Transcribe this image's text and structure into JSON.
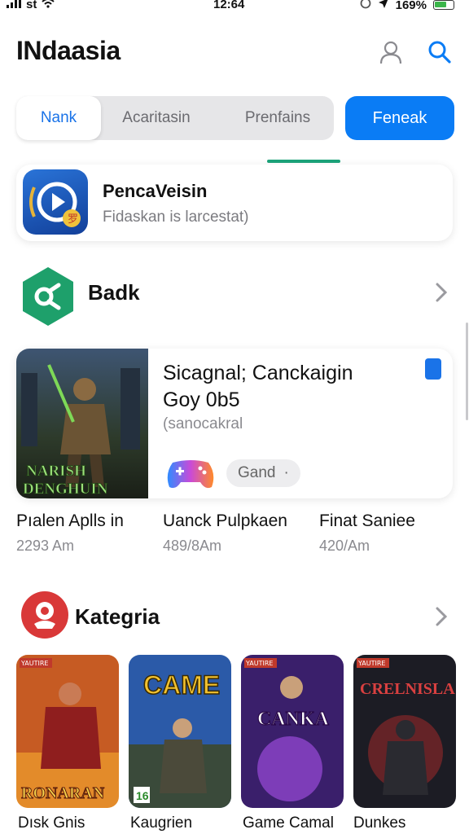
{
  "status_bar": {
    "carrier": "st",
    "time": "12:64",
    "battery": "169%"
  },
  "app": {
    "title": "INdaasia"
  },
  "segmented": {
    "items": [
      "Nank",
      "Acaritasin",
      "Prenfains"
    ],
    "active_index": 0
  },
  "primary_button": {
    "label": "Feneak"
  },
  "featured": {
    "title": "PencaVeisin",
    "subtitle": "Fidaskan is larcestat)"
  },
  "sections": [
    {
      "label": "Badk",
      "icon": "share-node-icon"
    },
    {
      "label": "Kategria",
      "icon": "emblem-icon"
    }
  ],
  "game_card": {
    "title_line1": "Sicagnal; Canckaigin",
    "title_line2": "Goy 0b5",
    "subtitle": "(sanocakral",
    "chip_label": "Gand",
    "chip_dot": "·",
    "art_title_1": "NARISH",
    "art_title_2": "DENGHUIN"
  },
  "trio": [
    {
      "title": "Pıalen Aplls in",
      "value": "2293 Am"
    },
    {
      "title": "Uanck Pulpkaen",
      "value": "489/8Am"
    },
    {
      "title": "Finat Saniee",
      "value": "420/Am"
    }
  ],
  "tiles": [
    {
      "label": "Dısk Gnis",
      "art_text": "RONARAN",
      "tag": "YAUTIRE",
      "colors": [
        "#b23c1f",
        "#e38b2a"
      ]
    },
    {
      "label": "Kaugrien",
      "art_text": "CAME",
      "tag": "16",
      "colors": [
        "#2b5aa8",
        "#f2c230"
      ]
    },
    {
      "label": "Game Camal",
      "art_text": "CANKA",
      "tag": "YAUTIRE",
      "colors": [
        "#3a1f6b",
        "#9a4ad8"
      ]
    },
    {
      "label": "Dunkes",
      "art_text": "CRELNISLA",
      "tag": "YAUTIRE",
      "colors": [
        "#1c1c24",
        "#a02a2a"
      ]
    }
  ],
  "colors": {
    "accent": "#0a7cf5",
    "green": "#1ca37a",
    "red": "#d93838"
  }
}
